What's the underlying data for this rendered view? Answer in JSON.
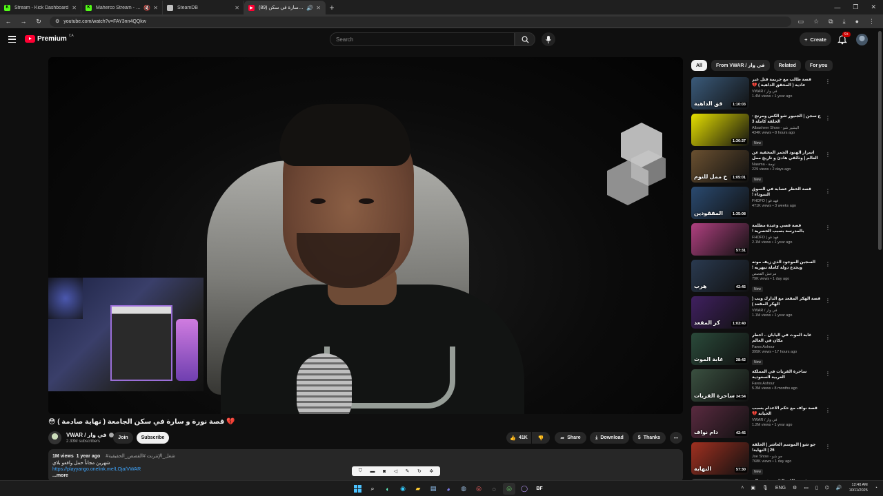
{
  "browser": {
    "tabs": [
      {
        "title": "Stream - Kick Dashboard",
        "fav_color": "#53fc18",
        "fav_letter": "K",
        "audio": ""
      },
      {
        "title": "Maherco Stream - Watch Li",
        "fav_color": "#53fc18",
        "fav_letter": "K",
        "audio": "🔇"
      },
      {
        "title": "SteamDB",
        "fav_color": "#c0c0c0",
        "fav_letter": "",
        "audio": ""
      },
      {
        "title": "(89) قصة نورة و سارة في سكن",
        "fav_color": "#ff0033",
        "fav_letter": "▶",
        "audio": "🔊"
      }
    ],
    "new_tab": "+",
    "url": "youtube.com/watch?v=FAY3nn4QQkw"
  },
  "youtube": {
    "logo_text": "Premium",
    "country": "CA",
    "search_placeholder": "Search",
    "create_label": "Create",
    "notif_badge": "9+"
  },
  "video": {
    "title": "💔 قصة نورة و سارة في سكن الجامعة ( نهاية صادمة ) 😳",
    "channel_name": "VWAR / في وار",
    "subscribers": "2.33M subscribers",
    "join_label": "Join",
    "subscribe_label": "Subscribe",
    "likes": "41K",
    "share_label": "Share",
    "download_label": "Download",
    "thanks_label": "Thanks",
    "more_label": "⋯",
    "views": "1M views",
    "age": "1 year ago",
    "tags": "#شغل_الإنترنت #القصص_الحقيقية",
    "desc_line": "شهرين مجاناً حمل وافعو بلاي",
    "link": "https://playyango.onelink.me/LOja/VWAR",
    "more_text": "...more"
  },
  "chips": [
    "All",
    "From VWAR / في وار",
    "Related",
    "For you"
  ],
  "recommendations": [
    {
      "title": "قصة طالب مع جريمة قتل غير عادية ( المحقق الداهية ) 💔",
      "channel": "VWAR / في وار",
      "meta": "1.4M views • 1 year ago",
      "duration": "1:10:03",
      "caption": "قق الداهية",
      "color": "#3a5a7a",
      "new": ""
    },
    {
      "title": "ج سجن | الجنيور شو الكس ومرنج - الحلقة كاملة 3",
      "channel": "Albasheer Show - البشير شو",
      "meta": "434K views • 8 hours ago",
      "duration": "1:30:37",
      "caption": "",
      "color": "#e6e000",
      "new": "New"
    },
    {
      "title": "اسرار الهنود الحمر المخفية عن العالم | وثائقي هادئ و تاريخ ممل للنوم",
      "channel": "Nawma - نومة",
      "meta": "229 views • 2 days ago",
      "duration": "1:05:01",
      "caption": "خ ممل للنوم",
      "color": "#6a5030",
      "new": "New"
    },
    {
      "title": "قصة الخطر عصابة في السوق السوداء !",
      "channel": "FHDFO | فهد فو",
      "meta": "471K views • 3 weeks ago",
      "duration": "1:35:08",
      "caption": "المفقودين",
      "color": "#2a4a70",
      "new": ""
    },
    {
      "title": "قصة قصي وعيدة مظلمة بالمدرسة بسبب الحصرية !",
      "channel": "FHDFO | فهد فو",
      "meta": "2.1M views • 1 year ago",
      "duration": "57:31",
      "caption": "",
      "color": "#b04080",
      "new": ""
    },
    {
      "title": "السجين الموجود الذي زيف موته ويخدع دولة كاملة تبهريه !",
      "channel": "مرعش القصص",
      "meta": "79K views • 1 day ago",
      "duration": "42:45",
      "caption": "هرب",
      "color": "#2a3a50",
      "new": "New"
    },
    {
      "title": "قصة الهكر المقعد مع الدارك ويب ( الهكر المقعد )",
      "channel": "VWAR / في وار",
      "meta": "1.1M views • 1 year ago",
      "duration": "1:03:40",
      "caption": "كر المقعد",
      "color": "#402060",
      "new": ""
    },
    {
      "title": "غابة الموت في اليابان .. أخطر مكان في العالم",
      "channel": "Fares Ashour",
      "meta": "395K views • 17 hours ago",
      "duration": "28:42",
      "caption": "غابة الموت",
      "color": "#2a4a3a",
      "new": "New"
    },
    {
      "title": "ساحرة القريات في المملكة العربية السعودية",
      "channel": "Fares Ashour",
      "meta": "5.3M views • 8 months ago",
      "duration": "34:54",
      "caption": "ساحرة القريات",
      "color": "#3a5040",
      "new": ""
    },
    {
      "title": "قصة نواف مع حكم الاعدام بسبب الخيانة 💔",
      "channel": "VWAR / في وار",
      "meta": "1.2M views • 1 year ago",
      "duration": "42:45",
      "caption": "دام نواف",
      "color": "#5a2a40",
      "new": ""
    },
    {
      "title": "جو شو | الموسم العاشر | الحلقة 26 | النهاية!",
      "channel": "Joe Show - جو شو",
      "meta": "768K views • 1 day ago",
      "duration": "57:30",
      "caption": "النهاية",
      "color": "#a03020",
      "new": "New"
    },
    {
      "title": "قصة طالب الثانوي في عالم الجريمة ( سجن",
      "channel": "",
      "meta": "",
      "duration": "",
      "caption": "",
      "color": "#3a3a3a",
      "new": ""
    }
  ],
  "taskbar": {
    "lang": "ENG",
    "time": "12:40 AM",
    "date": "10/11/2025"
  }
}
